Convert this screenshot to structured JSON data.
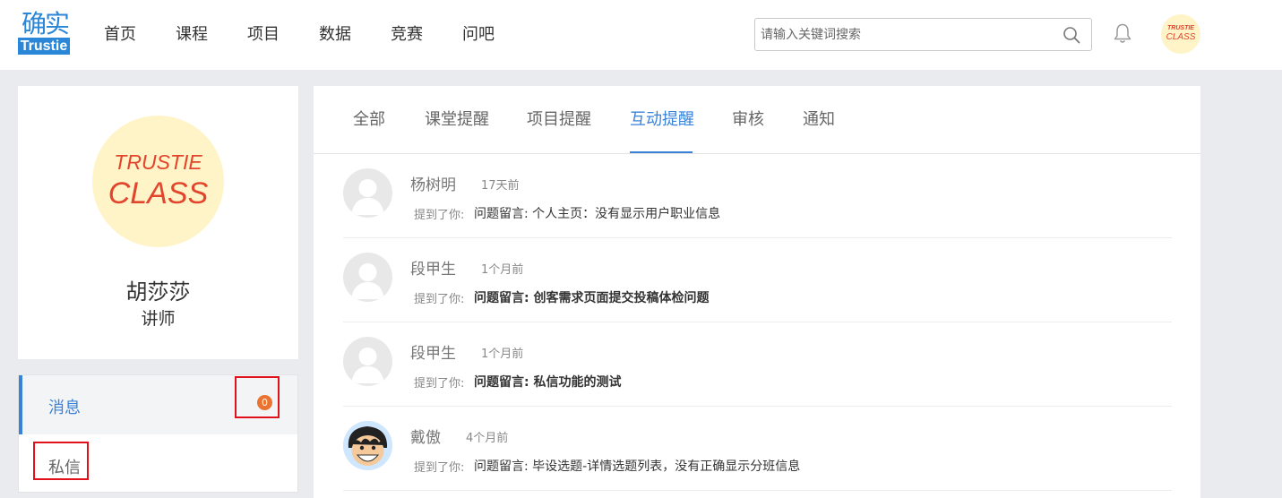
{
  "logo": {
    "top_text": "确实",
    "bottom_text": "Trustie"
  },
  "nav": [
    "首页",
    "课程",
    "项目",
    "数据",
    "竞赛",
    "问吧"
  ],
  "search": {
    "placeholder": "请输入关键词搜索",
    "value": ""
  },
  "header_avatar": {
    "line1": "TRUSTIE",
    "line2": "CLASS"
  },
  "profile": {
    "avatar_line1": "TRUSTIE",
    "avatar_line2": "CLASS",
    "name": "胡莎莎",
    "role": "讲师"
  },
  "side_menu": {
    "items": [
      {
        "label": "消息",
        "badge": "0",
        "active": true
      },
      {
        "label": "私信",
        "active": false
      }
    ]
  },
  "tabs": [
    {
      "label": "全部"
    },
    {
      "label": "课堂提醒"
    },
    {
      "label": "项目提醒"
    },
    {
      "label": "互动提醒",
      "active": true
    },
    {
      "label": "审核"
    },
    {
      "label": "通知"
    }
  ],
  "messages": [
    {
      "name": "杨树明",
      "time": "17天前",
      "mention": "提到了你:",
      "content": "问题留言: 个人主页：没有显示用户职业信息",
      "bold": false,
      "avatar": "default"
    },
    {
      "name": "段甲生",
      "time": "1个月前",
      "mention": "提到了你:",
      "content": "问题留言: 创客需求页面提交投稿体检问题",
      "bold": true,
      "avatar": "default"
    },
    {
      "name": "段甲生",
      "time": "1个月前",
      "mention": "提到了你:",
      "content": "问题留言: 私信功能的测试",
      "bold": true,
      "avatar": "default"
    },
    {
      "name": "戴傲",
      "time": "4个月前",
      "mention": "提到了你:",
      "content": "问题留言: 毕设选题-详情选题列表，没有正确显示分班信息",
      "bold": false,
      "avatar": "cartoon"
    }
  ],
  "colors": {
    "accent": "#3a82d8",
    "badge": "#ea7331",
    "highlight_box": "#e1101a"
  }
}
